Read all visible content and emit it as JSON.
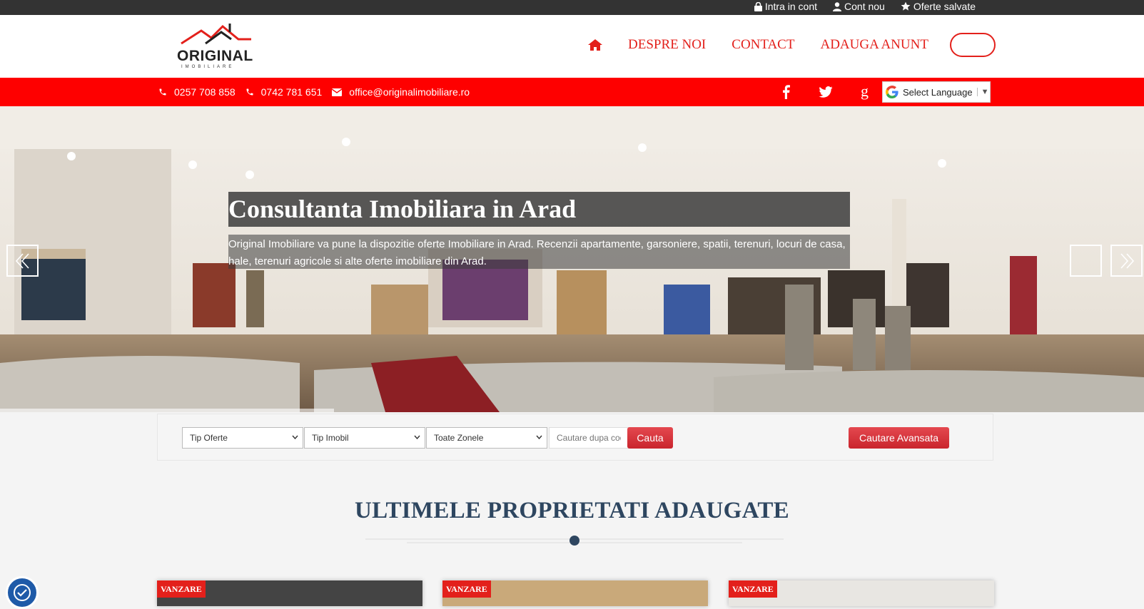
{
  "topbar": {
    "login": "Intra in cont",
    "register": "Cont nou",
    "saved": "Oferte salvate"
  },
  "logo": {
    "word": "ORIGINAL",
    "sub": "IMOBILIARE"
  },
  "nav": {
    "about": "DESPRE NOI",
    "contact": "CONTACT",
    "add": "ADAUGA ANUNT"
  },
  "contact": {
    "phone1": "0257 708 858",
    "phone2": "0742 781 651",
    "email": "office@originalimobiliare.ro"
  },
  "language": {
    "label": "Select Language",
    "arrow": "▼"
  },
  "hero": {
    "title": "Consultanta Imobiliara in Arad",
    "description": "Original Imobiliare va pune la dispozitie oferte Imobiliare in Arad. Recenzii apartamente, garsoniere, spatii, terenuri, locuri de casa, hale, terenuri agricole si alte oferte imobiliare din Arad."
  },
  "search": {
    "offer_type": "Tip Oferte",
    "property_type": "Tip Imobil",
    "zones": "Toate Zonele",
    "code_placeholder": "Cautare dupa cod",
    "search_btn": "Cauta",
    "advanced_btn": "Cautare Avansata"
  },
  "section": {
    "title": "ULTIMELE PROPRIETATI ADAUGATE"
  },
  "cards": [
    {
      "badge": "VANZARE"
    },
    {
      "badge": "VANZARE"
    },
    {
      "badge": "VANZARE"
    }
  ],
  "colors": {
    "accent": "#fe0000",
    "nav_red": "#e3201b",
    "title_blue": "#2e4660"
  }
}
